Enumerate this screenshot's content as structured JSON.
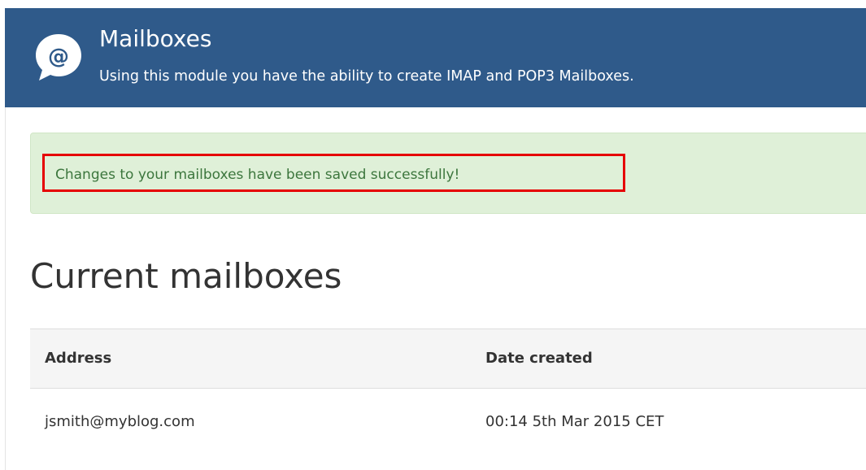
{
  "header": {
    "title": "Mailboxes",
    "subtitle": "Using this module you have the ability to create IMAP and POP3 Mailboxes.",
    "icon": "at-sign-speech-bubble-icon",
    "background_color": "#2f5a8a"
  },
  "alert": {
    "message": "Changes to your mailboxes have been saved successfully!",
    "background_color": "#dff0d8",
    "text_color": "#3c763d",
    "highlight_color": "#e60000"
  },
  "section": {
    "title": "Current mailboxes"
  },
  "table": {
    "columns": [
      "Address",
      "Date created"
    ],
    "rows": [
      [
        "jsmith@myblog.com",
        "00:14 5th Mar 2015 CET"
      ]
    ]
  }
}
